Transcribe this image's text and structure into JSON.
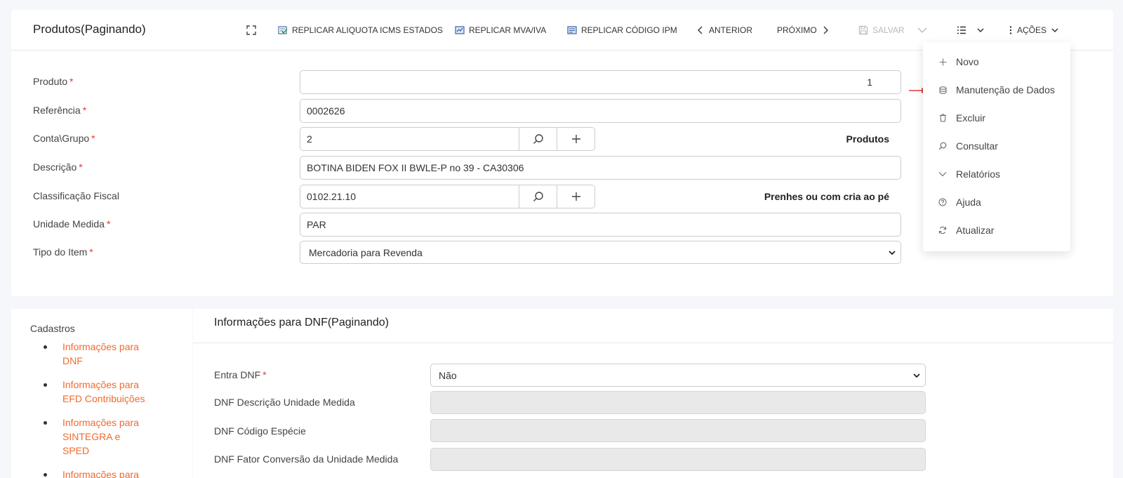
{
  "header": {
    "title": "Produtos(Paginando)",
    "replicar_icms": "REPLICAR ALIQUOTA ICMS ESTADOS",
    "replicar_mva": "REPLICAR MVA/IVA",
    "replicar_ipm": "REPLICAR CÓDIGO IPM",
    "anterior": "ANTERIOR",
    "proximo": "PRÓXIMO",
    "salvar": "SALVAR",
    "acoes": "AÇÕES"
  },
  "form": {
    "produto": {
      "label": "Produto",
      "value": "1"
    },
    "referencia": {
      "label": "Referência",
      "value": "0002626"
    },
    "conta_grupo": {
      "label": "Conta\\Grupo",
      "value": "2",
      "description": "Produtos"
    },
    "descricao": {
      "label": "Descrição",
      "value": "BOTINA BIDEN FOX II BWLE-P no 39 - CA30306"
    },
    "classificacao_fiscal": {
      "label": "Classificação Fiscal",
      "value": "0102.21.10",
      "description": "Prenhes ou com cria ao pé"
    },
    "unidade_medida": {
      "label": "Unidade Medida",
      "value": "PAR"
    },
    "tipo_item": {
      "label": "Tipo do Item",
      "value": "Mercadoria para Revenda"
    },
    "required_mark": "*"
  },
  "cadastros": {
    "title": "Cadastros",
    "items": [
      {
        "label": "Informações para DNF"
      },
      {
        "label": "Informações para EFD Contribuições"
      },
      {
        "label": "Informações para SINTEGRA e SPED"
      },
      {
        "label": "Informações para"
      }
    ]
  },
  "dnf": {
    "title": "Informações para DNF(Paginando)",
    "entra_dnf": {
      "label": "Entra DNF",
      "value": "Não"
    },
    "descricao_unidade": {
      "label": "DNF Descrição Unidade Medida",
      "value": ""
    },
    "codigo_especie": {
      "label": "DNF Código Espécie",
      "value": ""
    },
    "fator_conversao": {
      "label": "DNF Fator Conversão da Unidade Medida",
      "value": ""
    }
  },
  "menu": {
    "items": [
      {
        "label": "Novo",
        "icon": "plus-icon"
      },
      {
        "label": "Manutenção de Dados",
        "icon": "database-icon"
      },
      {
        "label": "Excluir",
        "icon": "trash-icon"
      },
      {
        "label": "Consultar",
        "icon": "search-icon"
      },
      {
        "label": "Relatórios",
        "icon": "chevron-down-icon"
      },
      {
        "label": "Ajuda",
        "icon": "help-icon"
      },
      {
        "label": "Atualizar",
        "icon": "refresh-icon"
      }
    ]
  },
  "colors": {
    "accent": "#f06a2e",
    "required": "#e53935",
    "arrow": "#e53935",
    "disabled": "#b8b8b8"
  }
}
